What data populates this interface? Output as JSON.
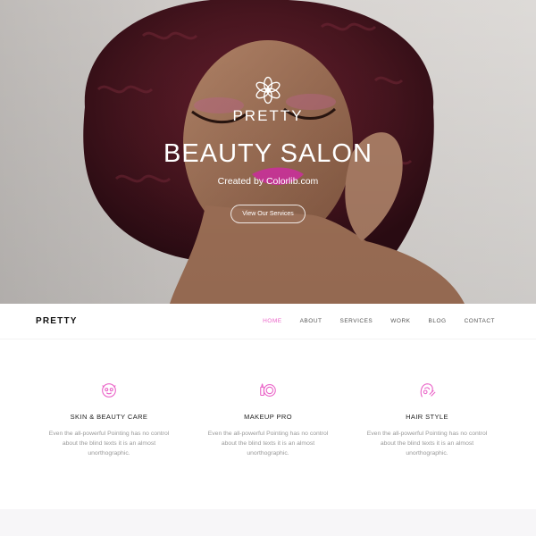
{
  "hero": {
    "brand": "PRETTY",
    "title": "BEAUTY SALON",
    "subtitle": "Created by Colorlib.com",
    "button_label": "View Our Services"
  },
  "nav": {
    "brand": "PRETTY",
    "items": [
      {
        "label": "HOME",
        "active": true
      },
      {
        "label": "ABOUT",
        "active": false
      },
      {
        "label": "SERVICES",
        "active": false
      },
      {
        "label": "WORK",
        "active": false
      },
      {
        "label": "BLOG",
        "active": false
      },
      {
        "label": "CONTACT",
        "active": false
      }
    ]
  },
  "services": [
    {
      "icon": "face-care-icon",
      "title": "SKIN & BEAUTY CARE",
      "text": "Even the all-powerful Pointing has no control about the blind texts it is an almost unorthographic."
    },
    {
      "icon": "makeup-icon",
      "title": "MAKEUP PRO",
      "text": "Even the all-powerful Pointing has no control about the blind texts it is an almost unorthographic."
    },
    {
      "icon": "hair-style-icon",
      "title": "HAIR STYLE",
      "text": "Even the all-powerful Pointing has no control about the blind texts it is an almost unorthographic."
    }
  ],
  "colors": {
    "accent": "#ea64c8",
    "nav_text": "#555555",
    "body_text": "#999999",
    "hair": "#4a1620"
  }
}
